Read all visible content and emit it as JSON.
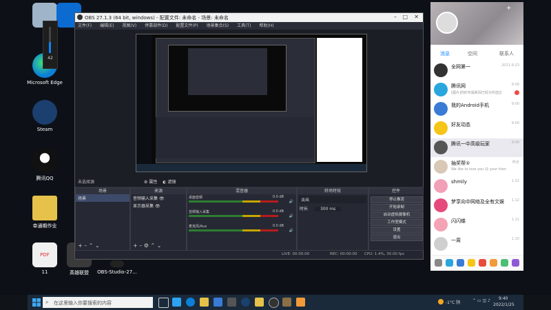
{
  "desktop_icons": [
    {
      "label": "",
      "color": "#9fb4c8"
    },
    {
      "label": "",
      "color": "#0b6bd1"
    },
    {
      "label": "Microsoft Edge",
      "color": "#0c7fd8"
    },
    {
      "label": "Steam",
      "color": "#1b3f6e"
    },
    {
      "label": "腾讯QQ",
      "color": "#111111"
    },
    {
      "label": "幸通期作业",
      "color": "#e6c24a"
    },
    {
      "label": "11",
      "color": "#f0f0f0"
    },
    {
      "label": "",
      "color": "#2a6fd1"
    },
    {
      "label": "英雄联盟",
      "color": "#3a3a3a"
    },
    {
      "label": "OBS-Studio-27...",
      "color": "#222"
    }
  ],
  "volume": {
    "level": 42,
    "display": "42"
  },
  "obs": {
    "title": "OBS 27.1.3 (64 bit, windows) - 配置文件: 未命名 - 场景: 未命名",
    "menu": [
      "文件(F)",
      "编辑(E)",
      "视图(V)",
      "停靠部件(D)",
      "配置文件(P)",
      "场景集合(S)",
      "工具(T)",
      "帮助(H)"
    ],
    "scene_label": "未选择源",
    "props_label": "属性",
    "filters_label": "滤镜",
    "docks": {
      "scenes": {
        "title": "场景",
        "items": [
          "场景"
        ]
      },
      "sources": {
        "title": "来源",
        "items": [
          "音频输入采集",
          "显示器采集"
        ]
      },
      "mixer": {
        "title": "混音器",
        "channels": [
          {
            "name": "桌面音频",
            "db": "0.0 dB"
          },
          {
            "name": "音频输入采集",
            "db": "0.0 dB"
          },
          {
            "name": "麦克风/Aux",
            "db": "0.0 dB"
          }
        ]
      },
      "transitions": {
        "title": "转场特效",
        "type": "淡出",
        "duration_label": "时长",
        "duration": "300 ms"
      },
      "controls": {
        "title": "控件",
        "buttons": [
          "停止推流",
          "开始录制",
          "启动虚拟摄像机",
          "工作室模式",
          "设置",
          "退出"
        ]
      }
    },
    "status": {
      "live": "LIVE: 00:00:00",
      "rec": "REC: 00:00:00",
      "cpu": "CPU: 1.4%, 30.00 fps"
    }
  },
  "qq": {
    "tabs": [
      "消息",
      "空间",
      "联系人"
    ],
    "contacts": [
      {
        "name": "全网第一",
        "msg": "",
        "time": "2021-9-23",
        "color": "#333333",
        "badge": false
      },
      {
        "name": "腾讯网",
        "msg": "[图片]你的专属新闻已经为你送达",
        "time": "9:00",
        "color": "#2aa6de",
        "badge": true
      },
      {
        "name": "我的Android手机",
        "msg": "",
        "time": "9:00",
        "color": "#3a7bd5",
        "badge": false
      },
      {
        "name": "好友动态",
        "msg": "",
        "time": "9:00",
        "color": "#f5c518",
        "badge": false
      },
      {
        "name": "腾讯一中高级玩家",
        "msg": "",
        "time": "9:00",
        "color": "#555555",
        "badge": false
      },
      {
        "name": "抽奖帮②",
        "msg": "We like to love you 😊 your friends",
        "time": "昨天",
        "color": "#d9c8b8",
        "badge": false
      },
      {
        "name": "shmily",
        "msg": "",
        "time": "1.22",
        "color": "#f2a0b8",
        "badge": false
      },
      {
        "name": "梦享向中网络及全有文娱",
        "msg": "",
        "time": "1.12",
        "color": "#e64a7a",
        "badge": false
      },
      {
        "name": "闪闪蝶",
        "msg": "",
        "time": "1.11",
        "color": "#f4a3b5",
        "badge": false
      },
      {
        "name": "一周",
        "msg": "",
        "time": "1.10",
        "color": "#cfcfcf",
        "badge": false
      }
    ]
  },
  "taskbar": {
    "search_placeholder": "在这里输入你要搜索的内容",
    "weather": "-1°C 阴",
    "time": "9:40",
    "date": "2022/1/25"
  }
}
